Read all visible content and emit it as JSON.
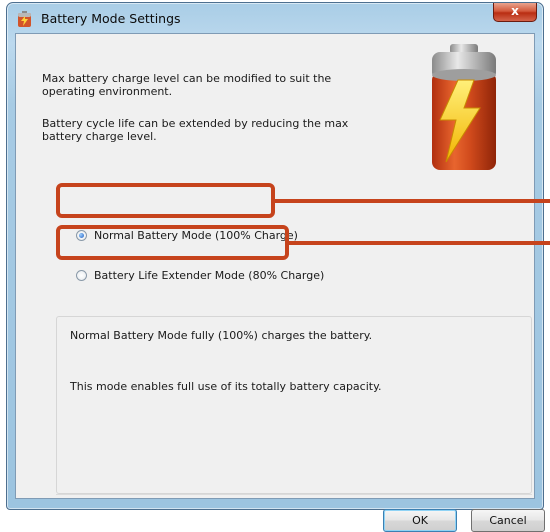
{
  "window": {
    "title": "Battery Mode Settings",
    "close_label": "x"
  },
  "intro": {
    "line1": "Max battery charge level can be modified to suit the operating environment.",
    "line2": "Battery cycle life can be extended by reducing the max battery charge level."
  },
  "modes": [
    {
      "label": "Normal Battery Mode (100% Charge)",
      "selected": true
    },
    {
      "label": "Battery Life Extender Mode (80% Charge)",
      "selected": false
    }
  ],
  "description": {
    "line1": "Normal Battery Mode fully (100%) charges the battery.",
    "line2": "This mode enables full use of its totally battery capacity."
  },
  "buttons": {
    "ok": "OK",
    "cancel": "Cancel"
  },
  "colors": {
    "highlight": "#c6431c",
    "accent": "#3c7fb1"
  },
  "icons": {
    "app": "battery-icon",
    "graphic": "battery-charging-icon",
    "close": "close-icon"
  }
}
